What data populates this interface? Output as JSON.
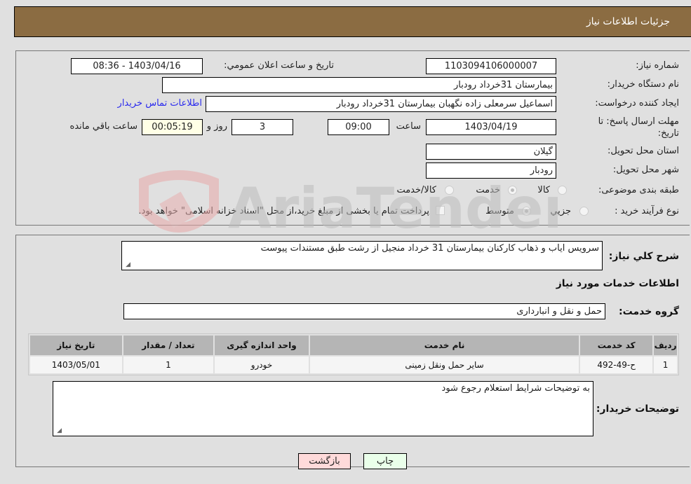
{
  "header": {
    "title": "جزئیات اطلاعات نیاز"
  },
  "form": {
    "need_number": {
      "label": "شماره نیاز:",
      "value": "1103094106000007"
    },
    "announce_datetime": {
      "label": "تاریخ و ساعت اعلان عمومي:",
      "value": "1403/04/16 - 08:36"
    },
    "buyer_org": {
      "label": "نام دستگاه خریدار:",
      "value": "بیمارستان 31خرداد رودبار"
    },
    "requester": {
      "label": "ایجاد کننده درخواست:",
      "value": "اسماعیل سرمعلی زاده نگهبان بیمارستان 31خرداد رودبار"
    },
    "buyer_contact_link": "اطلاعات تماس خریدار",
    "deadline": {
      "label_line1": "مهلت ارسال پاسخ: تا",
      "label_line2": "تاریخ:",
      "date": "1403/04/19",
      "time_label": "ساعت",
      "time": "09:00",
      "days": "3",
      "days_label": "روز و",
      "remaining": "00:05:19",
      "remaining_label": "ساعت باقي مانده"
    },
    "province": {
      "label": "استان محل تحویل:",
      "value": "گیلان"
    },
    "city": {
      "label": "شهر محل تحویل:",
      "value": "رودبار"
    },
    "category": {
      "label": "طبقه بندی موضوعی:",
      "options": [
        "کالا",
        "خدمت",
        "کالا/خدمت"
      ],
      "selected": "خدمت"
    },
    "purchase_type": {
      "label": "نوع فرآیند خرید :",
      "options": [
        "جزيي",
        "متوسط"
      ],
      "selected": "متوسط",
      "treasury_note": "پرداخت تمام یا بخشی از مبلغ خرید،از محل \"اسناد خزانه اسلامی\" خواهد بود."
    }
  },
  "details": {
    "description_label": "شرح كلي نياز:",
    "description": "سرویس ایاب و ذهاب کارکنان بیمارستان 31 خرداد منجیل از رشت طبق مستندات پیوست",
    "services_heading": "اطلاعات خدمات مورد نياز",
    "service_group_label": "گروه خدمت:",
    "service_group": "حمل و نقل و انبارداری",
    "table": {
      "headers": [
        "رديف",
        "كد خدمت",
        "نام خدمت",
        "واحد اندازه گیری",
        "تعداد / مقدار",
        "تاريخ نياز"
      ],
      "rows": [
        [
          "1",
          "ح-49-492",
          "سایر حمل ونقل زمینی",
          "خودرو",
          "1",
          "1403/05/01"
        ]
      ]
    },
    "buyer_notes_label": "توضيحات خريدار:",
    "buyer_notes": "به توضیحات شرایط استعلام رجوع شود"
  },
  "buttons": {
    "print": "چاپ",
    "back": "بازگشت"
  },
  "watermark": "AriaTender.neT"
}
